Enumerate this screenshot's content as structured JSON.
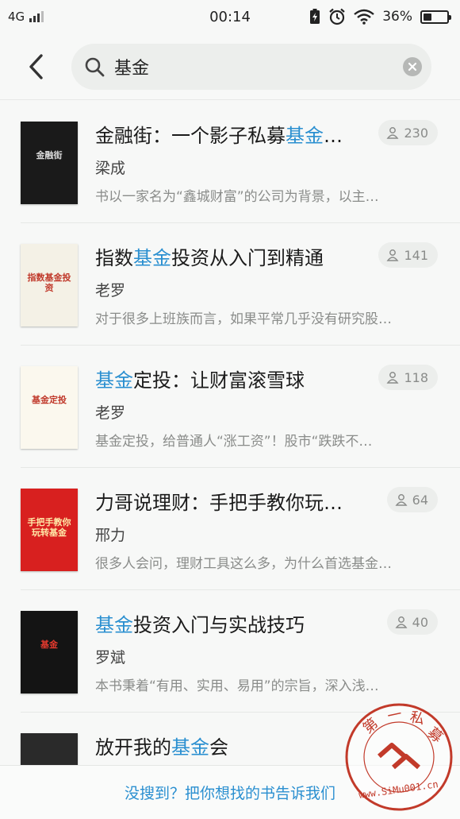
{
  "status_bar": {
    "network": "4G",
    "time": "00:14",
    "battery": "36%",
    "battery_level": 0.36
  },
  "search": {
    "query": "基金",
    "icons": {
      "back": "back-arrow-icon",
      "search": "search-icon",
      "clear": "clear-icon"
    }
  },
  "results": [
    {
      "title_parts": [
        {
          "t": "金融街：一个影子私募",
          "hl": false
        },
        {
          "t": "基金",
          "hl": true
        },
        {
          "t": "…",
          "hl": false
        }
      ],
      "author": "梁成",
      "description": "书以一家名为“鑫城财富”的公司为背景，以主…",
      "readers": "230",
      "cover": {
        "bg": "#1a1a1a",
        "text": "金融街",
        "text_color": "#d8d8d8"
      }
    },
    {
      "title_parts": [
        {
          "t": "指数",
          "hl": false
        },
        {
          "t": "基金",
          "hl": true
        },
        {
          "t": "投资从入门到精通",
          "hl": false
        }
      ],
      "author": "老罗",
      "description": "对于很多上班族而言，如果平常几乎没有研究股…",
      "readers": "141",
      "cover": {
        "bg": "#f4f1e6",
        "text": "指数基金投资",
        "text_color": "#c0392b"
      }
    },
    {
      "title_parts": [
        {
          "t": "基金",
          "hl": true
        },
        {
          "t": "定投：让财富滚雪球",
          "hl": false
        }
      ],
      "author": "老罗",
      "description": "基金定投，给普通人“涨工资”！股市“跌跌不…",
      "readers": "118",
      "cover": {
        "bg": "#fbf8ee",
        "text": "基金定投",
        "text_color": "#c0392b"
      }
    },
    {
      "title_parts": [
        {
          "t": "力哥说理财：手把手教你玩…",
          "hl": false
        }
      ],
      "author": "邢力",
      "description": "很多人会问，理财工具这么多，为什么首选基金…",
      "readers": "64",
      "cover": {
        "bg": "#d8201f",
        "text": "手把手教你玩转基金",
        "text_color": "#ffe9a8"
      }
    },
    {
      "title_parts": [
        {
          "t": "基金",
          "hl": true
        },
        {
          "t": "投资入门与实战技巧",
          "hl": false
        }
      ],
      "author": "罗斌",
      "description": "本书秉着“有用、实用、易用”的宗旨，深入浅…",
      "readers": "40",
      "cover": {
        "bg": "#141414",
        "text": "基金",
        "text_color": "#e53a2e"
      }
    },
    {
      "title_parts": [
        {
          "t": "放开我的",
          "hl": false
        },
        {
          "t": "基金",
          "hl": true
        },
        {
          "t": "会",
          "hl": false
        }
      ],
      "author": "",
      "description": "",
      "readers": "",
      "cover": {
        "bg": "#2a2a2a",
        "text": "",
        "text_color": "#ffffff"
      }
    }
  ],
  "footer": {
    "link": "没搜到？把你想找的书告诉我们"
  },
  "watermark": {
    "chars": [
      "第",
      "一",
      "私",
      "募"
    ],
    "url": "www.SiMu001.cn",
    "color": "#c23a2a"
  }
}
